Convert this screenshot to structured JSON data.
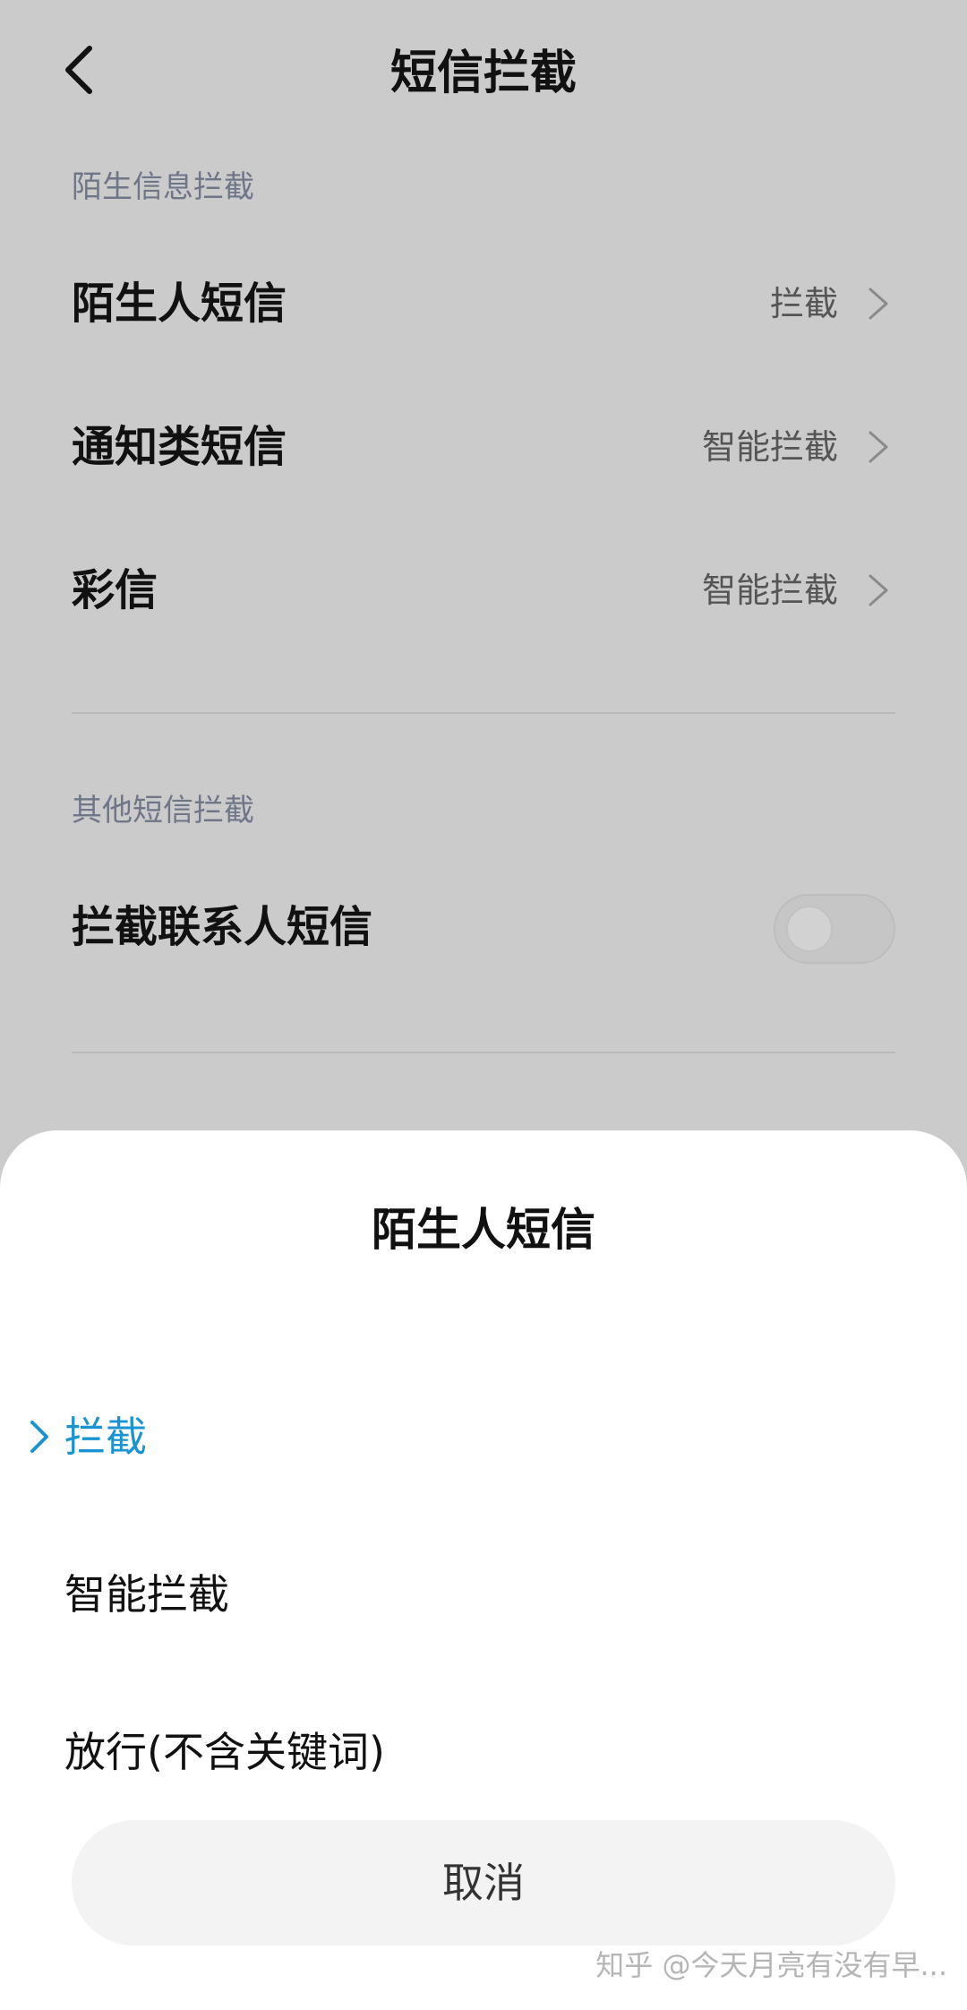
{
  "header": {
    "title": "短信拦截"
  },
  "sections": {
    "stranger": {
      "header": "陌生信息拦截",
      "rows": [
        {
          "label": "陌生人短信",
          "value": "拦截"
        },
        {
          "label": "通知类短信",
          "value": "智能拦截"
        },
        {
          "label": "彩信",
          "value": "智能拦截"
        }
      ]
    },
    "other": {
      "header": "其他短信拦截",
      "rows": [
        {
          "label": "拦截联系人短信",
          "toggle_on": false
        }
      ]
    }
  },
  "sheet": {
    "title": "陌生人短信",
    "options": [
      {
        "label": "拦截",
        "selected": true
      },
      {
        "label": "智能拦截",
        "selected": false
      },
      {
        "label": "放行(不含关键词)",
        "selected": false
      }
    ],
    "cancel_label": "取消"
  },
  "watermark": "知乎 @今天月亮有没有早...",
  "colors": {
    "accent": "#1a93d1",
    "dim_background": "#cbcbcb",
    "sheet_background": "#ffffff"
  }
}
